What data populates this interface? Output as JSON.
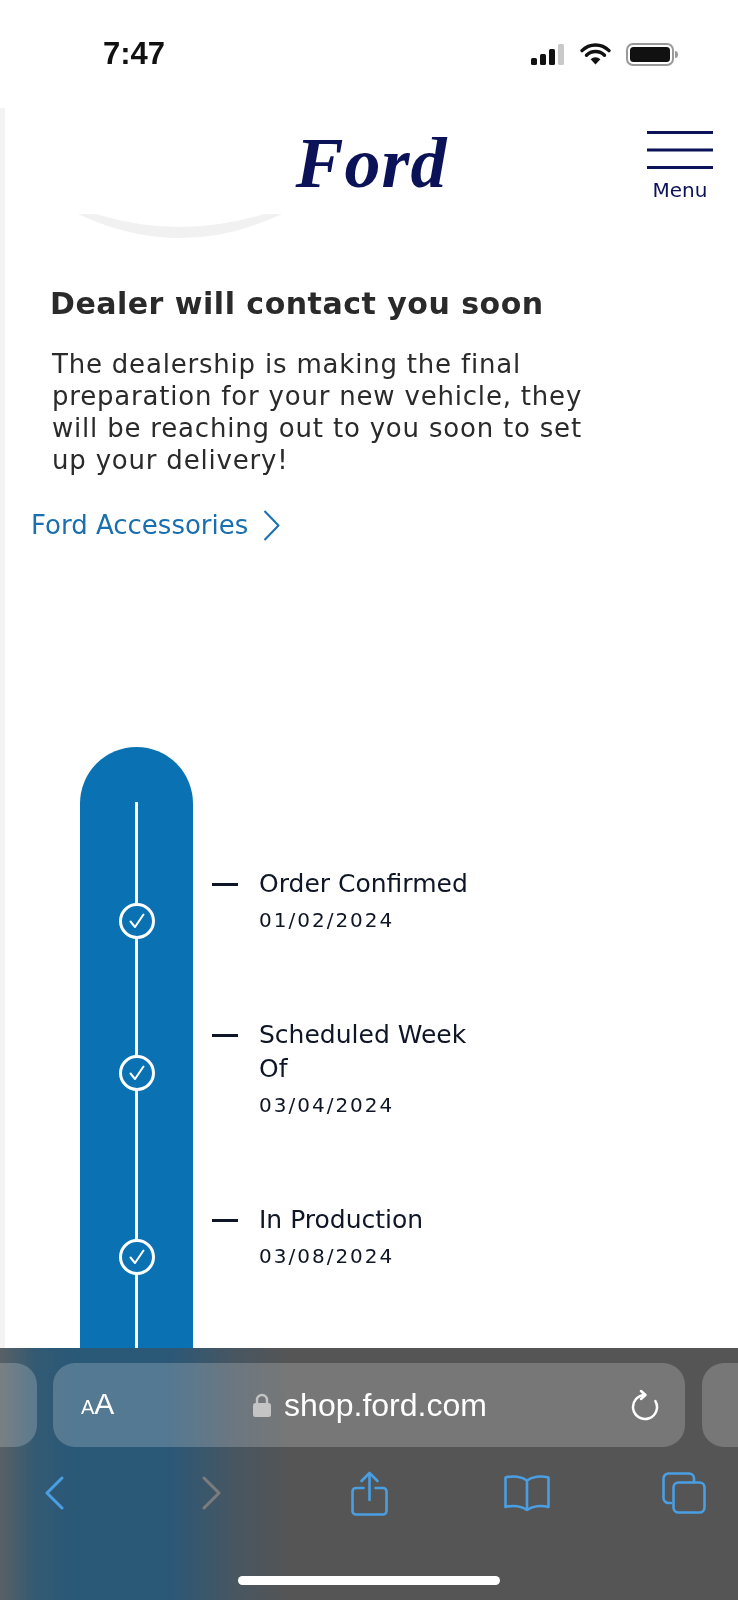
{
  "status_bar": {
    "time": "7:47"
  },
  "header": {
    "logo": "Ford",
    "menu_label": "Menu"
  },
  "notice": {
    "title": "Dealer will contact you soon",
    "body": "The dealership is making the final preparation for your new vehicle, they will be reaching out to you soon to set up your delivery!",
    "link": "Ford Accessories"
  },
  "timeline": {
    "steps": [
      {
        "title": "Order Confirmed",
        "date": "01/02/2024",
        "completed": true
      },
      {
        "title": "Scheduled Week Of",
        "date": "03/04/2024",
        "completed": true
      },
      {
        "title": "In Production",
        "date": "03/08/2024",
        "completed": true
      }
    ]
  },
  "browser": {
    "text_size": "AA",
    "url": "shop.ford.com",
    "secure": true,
    "toolbar": [
      {
        "kind": "back",
        "disabled": false
      },
      {
        "kind": "forward",
        "disabled": true
      },
      {
        "kind": "share",
        "disabled": false
      },
      {
        "kind": "bookmarks",
        "disabled": false
      },
      {
        "kind": "tabs",
        "disabled": false
      }
    ]
  }
}
